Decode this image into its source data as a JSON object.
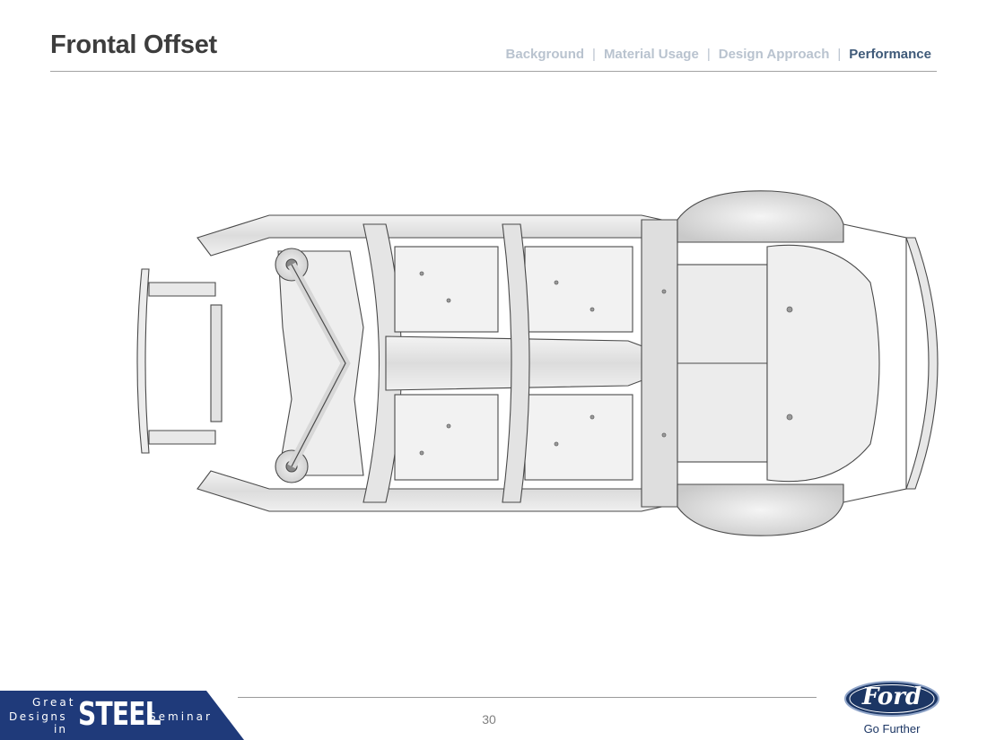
{
  "header": {
    "title": "Frontal Offset",
    "nav": [
      {
        "label": "Background",
        "active": false
      },
      {
        "label": "Material Usage",
        "active": false
      },
      {
        "label": "Design Approach",
        "active": false
      },
      {
        "label": "Performance",
        "active": true
      }
    ],
    "separator": "|"
  },
  "figure": {
    "icon": "vehicle-underbody-steel-structure"
  },
  "footer": {
    "page_number": "30",
    "seminar_logo": {
      "line1": "Great",
      "line2": "Designs",
      "line3": "in",
      "emphasis": "STEEL",
      "suffix": "Seminar",
      "band_color": "#1f3a7a"
    },
    "brand": {
      "name": "Ford",
      "tagline": "Go Further",
      "color": "#1c3664"
    }
  },
  "colors": {
    "title": "#3d3d3d",
    "nav_inactive": "#b9c3cf",
    "nav_active": "#3f5a79"
  }
}
